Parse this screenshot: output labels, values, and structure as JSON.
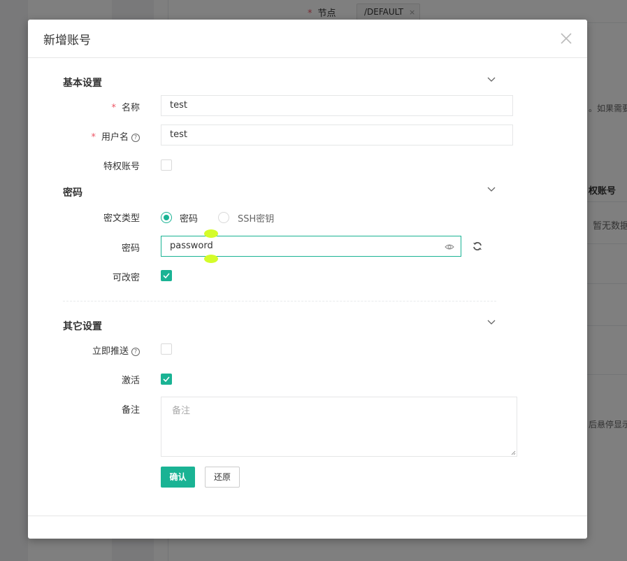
{
  "background": {
    "node_label": "节点",
    "node_tag": "/DEFAULT",
    "hint_text": "。如果需要",
    "table_header": "权账号",
    "empty_text": "暂无数据",
    "hover_text": "后悬停显示"
  },
  "modal": {
    "title": "新增账号",
    "close_icon": "close-icon"
  },
  "sections": {
    "basic": "基本设置",
    "password": "密码",
    "other": "其它设置"
  },
  "fields": {
    "name_label": "名称",
    "name_value": "test",
    "username_label": "用户名",
    "username_value": "test",
    "privileged_label": "特权账号",
    "privileged_checked": false,
    "secret_type_label": "密文类型",
    "secret_type_options": [
      "密码",
      "SSH密钥"
    ],
    "secret_type_selected": "密码",
    "password_label": "密码",
    "password_value": "password",
    "changeable_label": "可改密",
    "changeable_checked": true,
    "push_now_label": "立即推送",
    "push_now_checked": false,
    "active_label": "激活",
    "active_checked": true,
    "comment_label": "备注",
    "comment_placeholder": "备注"
  },
  "buttons": {
    "confirm": "确认",
    "reset": "还原"
  },
  "colors": {
    "accent": "#1ab394",
    "required": "#ed5565"
  }
}
